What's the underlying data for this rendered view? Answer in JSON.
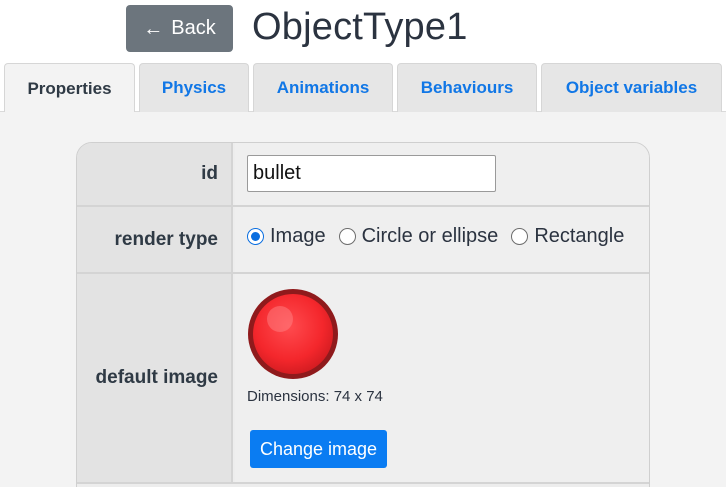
{
  "header": {
    "back_label": "Back",
    "title": "ObjectType1"
  },
  "tabs": [
    {
      "label": "Properties",
      "active": true
    },
    {
      "label": "Physics",
      "active": false
    },
    {
      "label": "Animations",
      "active": false
    },
    {
      "label": "Behaviours",
      "active": false
    },
    {
      "label": "Object variables",
      "active": false
    }
  ],
  "properties": {
    "id": {
      "label": "id",
      "value": "bullet"
    },
    "render_type": {
      "label": "render type",
      "options": [
        "Image",
        "Circle or ellipse",
        "Rectangle"
      ],
      "selected": "Image"
    },
    "default_image": {
      "label": "default image",
      "dimensions_text": "Dimensions: 74 x 74",
      "change_label": "Change image",
      "image_icon": "red-ball-sprite"
    }
  },
  "colors": {
    "back_button": "#6c757d",
    "accent": "#0a7cf2",
    "tab_link": "#1177e6"
  }
}
